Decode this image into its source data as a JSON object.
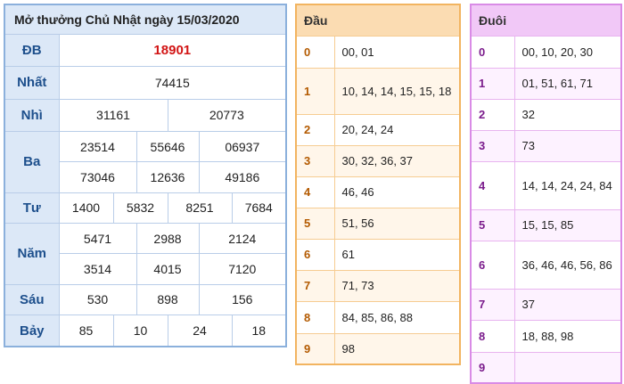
{
  "results": {
    "title": "Mở thưởng Chủ Nhật ngày 15/03/2020",
    "db": {
      "label": "ĐB",
      "values": [
        "18901"
      ]
    },
    "nhat": {
      "label": "Nhất",
      "values": [
        "74415"
      ]
    },
    "nhi": {
      "label": "Nhì",
      "values": [
        "31161",
        "20773"
      ]
    },
    "ba": {
      "label": "Ba",
      "values": [
        "23514",
        "55646",
        "06937",
        "73046",
        "12636",
        "49186"
      ]
    },
    "tu": {
      "label": "Tư",
      "values": [
        "1400",
        "5832",
        "8251",
        "7684"
      ]
    },
    "nam": {
      "label": "Năm",
      "values": [
        "5471",
        "2988",
        "2124",
        "3514",
        "4015",
        "7120"
      ]
    },
    "sau": {
      "label": "Sáu",
      "values": [
        "530",
        "898",
        "156"
      ]
    },
    "bay": {
      "label": "Bảy",
      "values": [
        "85",
        "10",
        "24",
        "18"
      ]
    }
  },
  "dau": {
    "header": "Đầu",
    "rows": [
      {
        "key": "0",
        "value": "00, 01"
      },
      {
        "key": "1",
        "value": "10, 14, 14, 15, 15, 18"
      },
      {
        "key": "2",
        "value": "20, 24, 24"
      },
      {
        "key": "3",
        "value": "30, 32, 36, 37"
      },
      {
        "key": "4",
        "value": "46, 46"
      },
      {
        "key": "5",
        "value": "51, 56"
      },
      {
        "key": "6",
        "value": "61"
      },
      {
        "key": "7",
        "value": "71, 73"
      },
      {
        "key": "8",
        "value": "84, 85, 86, 88"
      },
      {
        "key": "9",
        "value": "98"
      }
    ]
  },
  "duoi": {
    "header": "Đuôi",
    "rows": [
      {
        "key": "0",
        "value": "00, 10, 20, 30"
      },
      {
        "key": "1",
        "value": "01, 51, 61, 71"
      },
      {
        "key": "2",
        "value": "32"
      },
      {
        "key": "3",
        "value": "73"
      },
      {
        "key": "4",
        "value": "14, 14, 24, 24, 84"
      },
      {
        "key": "5",
        "value": "15, 15, 85"
      },
      {
        "key": "6",
        "value": "36, 46, 46, 56, 86"
      },
      {
        "key": "7",
        "value": "37"
      },
      {
        "key": "8",
        "value": "18, 88, 98"
      },
      {
        "key": "9",
        "value": ""
      }
    ]
  },
  "colors": {
    "special_prize": "#d21515",
    "results_border": "#8bb0dc",
    "dau_border": "#f2b460",
    "duoi_border": "#d98be6"
  }
}
